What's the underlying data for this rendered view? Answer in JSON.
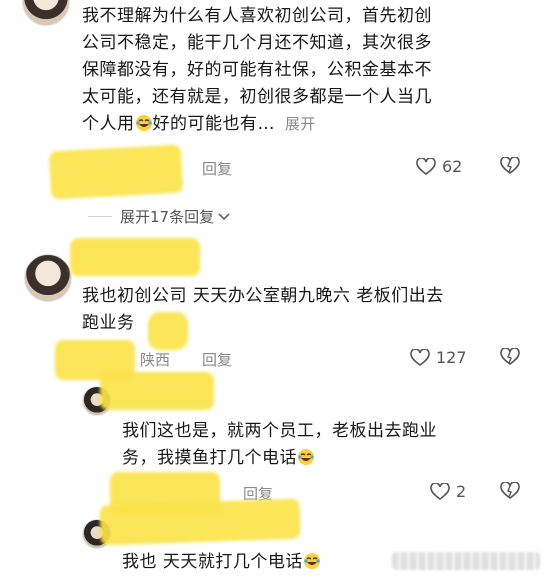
{
  "comments": [
    {
      "text_lines": [
        "我不理解为什么有人喜欢初创公司，首先初创",
        "公司不稳定，能干几个月还不知道，其次很多",
        "保障都没有，好的可能有社保，公积金基本不",
        "太可能，还有就是，初创很多都是一个人当几"
      ],
      "last_line_pre": "个人用",
      "last_line_post": "好的可能也有…",
      "expand_label": "展开",
      "reply_label": "回复",
      "likes": "62"
    },
    {
      "text_lines": [
        "我也初创公司 天天办公室朝九晚六 老板们出去"
      ],
      "last_line": "跑业务",
      "location": "陕西",
      "reply_label": "回复",
      "likes": "127"
    }
  ],
  "expand_replies_label": "展开17条回复",
  "replies": [
    {
      "text_lines": [
        "我们这也是，就两个员工，老板出去跑业"
      ],
      "last_line": "务，我摸鱼打几个电话",
      "reply_label": "回复",
      "likes": "2"
    },
    {
      "text": "我也 天天就打几个电话"
    }
  ],
  "colors": {
    "redaction": "#fbe34a",
    "meta_text": "#8a8a8a"
  }
}
